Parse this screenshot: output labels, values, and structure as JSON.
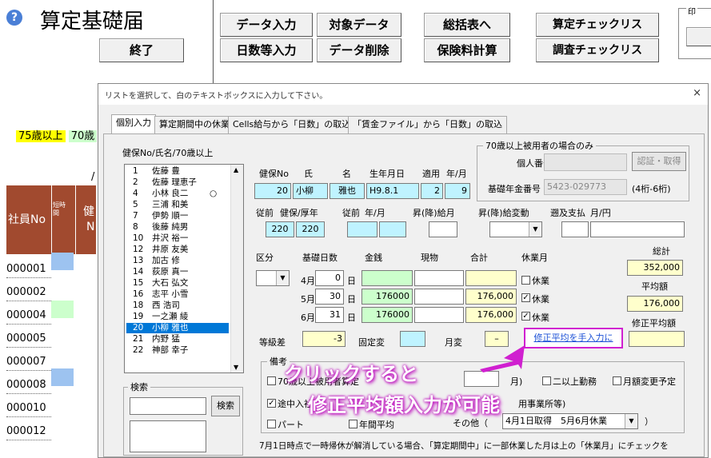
{
  "sheet": {
    "title": "算定基礎届",
    "help_icon": "?",
    "buttons": [
      "終了",
      "データ入力",
      "対象データ",
      "総括表へ",
      "算定チェックリス",
      "日数等入力",
      "データ削除",
      "保険料計算",
      "調査チェックリス"
    ],
    "print_label": "印",
    "age_yellow": "75歳以上",
    "age_green": "70歳",
    "col_header_1": "社員No",
    "col_header_2": "短時間",
    "col_header_3": "健",
    "col_header_4": "N",
    "employees": [
      "000001",
      "000002",
      "000004",
      "000005",
      "000007",
      "000008",
      "000010",
      "000012"
    ],
    "slash": "/"
  },
  "dialog": {
    "titlebar": "リストを選択して、白のテキストボックスに入力して下さい。",
    "close": "×",
    "tabs": [
      "個別入力",
      "算定期間中の休業",
      "Cells給与から「日数」の取込",
      "「賃金ファイル」から「日数」の取込"
    ],
    "list_caption": "健保No/氏名/70歳以上",
    "list_items": [
      {
        "no": "1",
        "name": "佐藤 豊",
        "mark": ""
      },
      {
        "no": "2",
        "name": "佐藤 理恵子",
        "mark": ""
      },
      {
        "no": "4",
        "name": "小林 良二",
        "mark": "○"
      },
      {
        "no": "5",
        "name": "三浦 和美",
        "mark": ""
      },
      {
        "no": "7",
        "name": "伊勢 順一",
        "mark": ""
      },
      {
        "no": "8",
        "name": "後藤 純男",
        "mark": ""
      },
      {
        "no": "10",
        "name": "井沢 裕一",
        "mark": ""
      },
      {
        "no": "12",
        "name": "井原 友美",
        "mark": ""
      },
      {
        "no": "13",
        "name": "加古 修",
        "mark": ""
      },
      {
        "no": "14",
        "name": "荻原 真一",
        "mark": ""
      },
      {
        "no": "15",
        "name": "大石 弘文",
        "mark": ""
      },
      {
        "no": "16",
        "name": "志平 小雪",
        "mark": ""
      },
      {
        "no": "18",
        "name": "西 浩司",
        "mark": ""
      },
      {
        "no": "19",
        "name": "一之瀬 綾",
        "mark": ""
      },
      {
        "no": "20",
        "name": "小柳 雅也",
        "mark": ""
      },
      {
        "no": "21",
        "name": "内野 猛",
        "mark": ""
      },
      {
        "no": "22",
        "name": "神部 幸子",
        "mark": ""
      }
    ],
    "selected_index": 14,
    "search_group": "検索",
    "search_button": "検索",
    "labels": {
      "kenpo_no": "健保No",
      "shi": "氏",
      "mei": "名",
      "birth": "生年月日",
      "tekiyo": "適用",
      "ym": "年/月",
      "jyuzen": "従前",
      "kenpo_kousei": "健保/厚年",
      "jyuzen2": "従前",
      "ym2": "年/月",
      "shoukou_kyuyo": "昇(降)給月",
      "shoukou_kyuyo_hendo": "昇(降)給変動",
      "sokyu": "遡及支払",
      "tsuki_en": "月/円",
      "kubun": "区分",
      "kiso_nissu": "基礎日数",
      "kinsen": "金銭",
      "genbutsu": "現物",
      "goukei": "合計",
      "kyugyo_tsuki": "休業月",
      "soukei": "総計",
      "heikin": "平均額",
      "shusei_heikin": "修正平均額",
      "toukyu": "等級差",
      "kotei": "固定変",
      "getsuhen": "月変",
      "over70_group": "70歳以上被用者の場合のみ",
      "kojin_bango": "個人番号",
      "kiso_nenkin": "基礎年金番号",
      "keta": "(4桁-6桁)",
      "auth_button": "認証・取得",
      "bikou": "備考",
      "over70_check": "70歳以上被用者算定",
      "nijou": "二以上勤務",
      "gakugen": "月額変更予定",
      "tochu": "途中入社",
      "part": "パート",
      "nenkan": "年間平均",
      "sonota": "その他（",
      "sonota_close": "）",
      "jigyousho": "用事業所等)",
      "kakko": "月)",
      "bottom_note": "7月1日時点で一時帰休が解消している場合、「算定期間中」に一部休業した月は上の「休業月」にチェックを"
    },
    "values": {
      "kenpo_no": "20",
      "shi": "小柳",
      "mei": "雅也",
      "birth": "H9.8.1",
      "tekiyo_y": "2",
      "tekiyo_m": "9",
      "jyuzen_kenpo": "220",
      "jyuzen_kousei": "220",
      "kiso_nenkin": "5423-029773",
      "months": [
        {
          "m": "4月",
          "days": "0",
          "unit": "日",
          "kinsen": "",
          "genbutsu": "",
          "goukei": "",
          "kyugyo": "休業",
          "checked": false
        },
        {
          "m": "5月",
          "days": "30",
          "unit": "日",
          "kinsen": "176000",
          "genbutsu": "",
          "goukei": "176,000",
          "kyugyo": "休業",
          "checked": true
        },
        {
          "m": "6月",
          "days": "31",
          "unit": "日",
          "kinsen": "176000",
          "genbutsu": "",
          "goukei": "176,000",
          "kyugyo": "休業",
          "checked": true
        }
      ],
      "soukei": "352,000",
      "heikin": "176,000",
      "toukyu": "-3",
      "getsuhen": "–",
      "sonota_value": "4月1日取得　5月6月休業"
    },
    "link_text": "修正平均を手入力に"
  },
  "annotation": {
    "line1": "クリックすると",
    "line2": "修正平均額入力が可能"
  },
  "colors": {
    "header": "#a14a2f",
    "cyan_field": "#bff3ff",
    "yellow_field": "#ffffcc",
    "green_field": "#ccffcc",
    "selection": "#0078d7",
    "annotation": "#d020d0"
  }
}
